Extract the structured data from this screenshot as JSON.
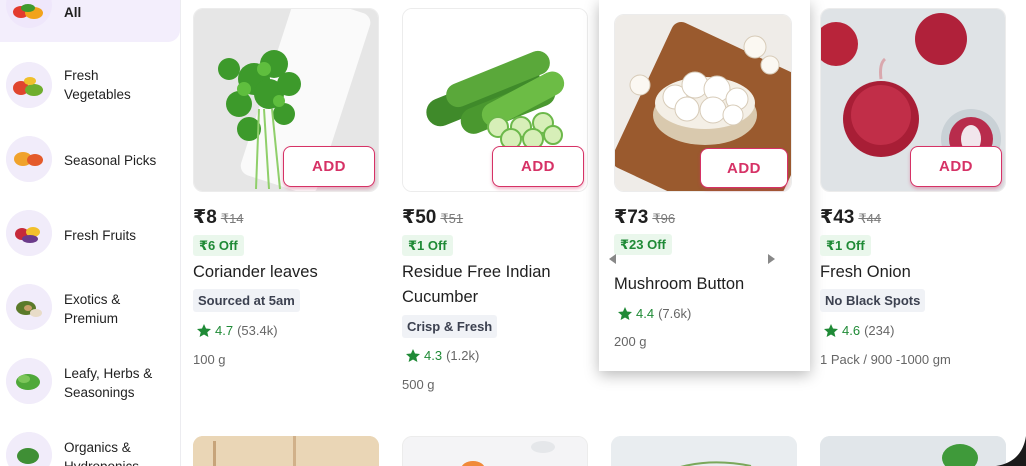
{
  "sidebar": {
    "items": [
      {
        "label": "All",
        "active": true
      },
      {
        "label": "Fresh\nVegetables"
      },
      {
        "label": "Seasonal Picks"
      },
      {
        "label": "Fresh Fruits"
      },
      {
        "label": "Exotics &\nPremium"
      },
      {
        "label": "Leafy, Herbs &\nSeasonings"
      },
      {
        "label": "Organics &\nHydroponics"
      }
    ]
  },
  "products": [
    {
      "add_label": "ADD",
      "price": "₹8",
      "mrp": "₹14",
      "offer": "₹6 Off",
      "name": "Coriander leaves",
      "tag": "Sourced at 5am",
      "rating": "4.7",
      "rating_count": "(53.4k)",
      "quantity": "100 g"
    },
    {
      "add_label": "ADD",
      "price": "₹50",
      "mrp": "₹51",
      "offer": "₹1 Off",
      "name": "Residue Free Indian\nCucumber",
      "tag": "Crisp & Fresh",
      "rating": "4.3",
      "rating_count": "(1.2k)",
      "quantity": "500 g"
    },
    {
      "add_label": "ADD",
      "price": "₹73",
      "mrp": "₹96",
      "offer": "₹23 Off",
      "name": "Mushroom Button",
      "rating": "4.4",
      "rating_count": "(7.6k)",
      "quantity": "200 g"
    },
    {
      "add_label": "ADD",
      "price": "₹43",
      "mrp": "₹44",
      "offer": "₹1 Off",
      "name": "Fresh Onion",
      "tag": "No Black Spots",
      "rating": "4.6",
      "rating_count": "(234)",
      "quantity": "1 Pack / 900 -1000 gm"
    }
  ],
  "colors": {
    "accent": "#d63266",
    "offer_green": "#1f8a36",
    "active_sidebar_bg": "#f3eefc"
  }
}
